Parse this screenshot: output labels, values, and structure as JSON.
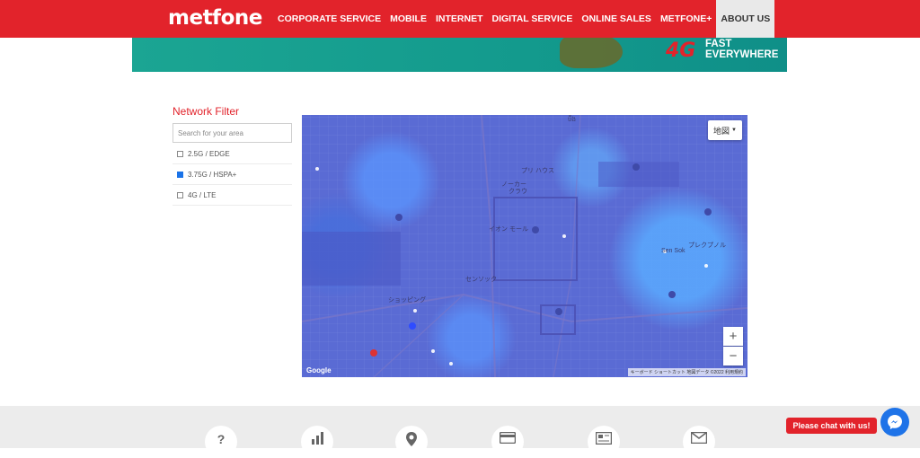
{
  "header": {
    "logo": "metfone",
    "nav": [
      {
        "label": "CORPORATE SERVICE"
      },
      {
        "label": "MOBILE"
      },
      {
        "label": "INTERNET"
      },
      {
        "label": "DIGITAL SERVICE"
      },
      {
        "label": "ONLINE SALES"
      },
      {
        "label": "METFONE+"
      },
      {
        "label": "ABOUT US"
      }
    ],
    "active_nav": "ABOUT US",
    "brand_color": "#e2232b"
  },
  "banner": {
    "badge": "4G",
    "tagline_line1": "FAST",
    "tagline_line2": "EVERYWHERE"
  },
  "filter": {
    "title": "Network Filter",
    "search_placeholder": "Search for your area",
    "options": [
      {
        "label": "2.5G / EDGE",
        "checked": false
      },
      {
        "label": "3.75G / HSPA+",
        "checked": true
      },
      {
        "label": "4G / LTE",
        "checked": false
      }
    ]
  },
  "map": {
    "type_button": "地図",
    "zoom_in": "+",
    "zoom_out": "−",
    "logo": "Google",
    "attribution": "キーボード ショートカット   地図データ ©2022   利用規約",
    "labels": [
      "បឹង",
      "プリ ハウス",
      "ノーカー",
      "クラウ",
      "イオン モール",
      "センソック",
      "ショッピング",
      "Sen Sok",
      "プレクプノル"
    ]
  },
  "chat": {
    "label": "Please chat with us!"
  },
  "footer_icons": [
    "question-icon",
    "chart-icon",
    "location-icon",
    "card-icon",
    "news-icon",
    "mail-icon"
  ]
}
